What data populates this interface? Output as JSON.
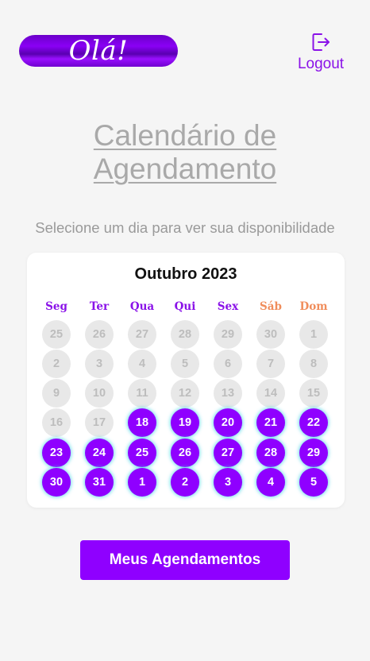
{
  "header": {
    "greeting": "Olá!",
    "logout_label": "Logout"
  },
  "page": {
    "title_line1": "Calendário de",
    "title_line2": "Agendamento",
    "subtitle": "Selecione um dia para ver sua disponibilidade"
  },
  "calendar": {
    "month_label": "Outubro 2023",
    "weekdays": [
      "Seg",
      "Ter",
      "Qua",
      "Qui",
      "Sex",
      "Sáb",
      "Dom"
    ],
    "weekend_indexes": [
      5,
      6
    ],
    "weeks": [
      [
        {
          "d": "25",
          "on": false
        },
        {
          "d": "26",
          "on": false
        },
        {
          "d": "27",
          "on": false
        },
        {
          "d": "28",
          "on": false
        },
        {
          "d": "29",
          "on": false
        },
        {
          "d": "30",
          "on": false
        },
        {
          "d": "1",
          "on": false
        }
      ],
      [
        {
          "d": "2",
          "on": false
        },
        {
          "d": "3",
          "on": false
        },
        {
          "d": "4",
          "on": false
        },
        {
          "d": "5",
          "on": false
        },
        {
          "d": "6",
          "on": false
        },
        {
          "d": "7",
          "on": false
        },
        {
          "d": "8",
          "on": false
        }
      ],
      [
        {
          "d": "9",
          "on": false
        },
        {
          "d": "10",
          "on": false
        },
        {
          "d": "11",
          "on": false
        },
        {
          "d": "12",
          "on": false
        },
        {
          "d": "13",
          "on": false
        },
        {
          "d": "14",
          "on": false
        },
        {
          "d": "15",
          "on": false
        }
      ],
      [
        {
          "d": "16",
          "on": false
        },
        {
          "d": "17",
          "on": false
        },
        {
          "d": "18",
          "on": true
        },
        {
          "d": "19",
          "on": true
        },
        {
          "d": "20",
          "on": true
        },
        {
          "d": "21",
          "on": true
        },
        {
          "d": "22",
          "on": true
        }
      ],
      [
        {
          "d": "23",
          "on": true
        },
        {
          "d": "24",
          "on": true
        },
        {
          "d": "25",
          "on": true
        },
        {
          "d": "26",
          "on": true
        },
        {
          "d": "27",
          "on": true
        },
        {
          "d": "28",
          "on": true
        },
        {
          "d": "29",
          "on": true
        }
      ],
      [
        {
          "d": "30",
          "on": true
        },
        {
          "d": "31",
          "on": true
        },
        {
          "d": "1",
          "on": true
        },
        {
          "d": "2",
          "on": true
        },
        {
          "d": "3",
          "on": true
        },
        {
          "d": "4",
          "on": true
        },
        {
          "d": "5",
          "on": true
        }
      ]
    ]
  },
  "actions": {
    "my_appointments_label": "Meus Agendamentos"
  },
  "colors": {
    "accent": "#8f00ff",
    "weekend": "#f08d5b",
    "disabled_day_bg": "#e8e8e8",
    "background": "#f5f5f5"
  },
  "icons": {
    "logout": "logout-icon"
  }
}
